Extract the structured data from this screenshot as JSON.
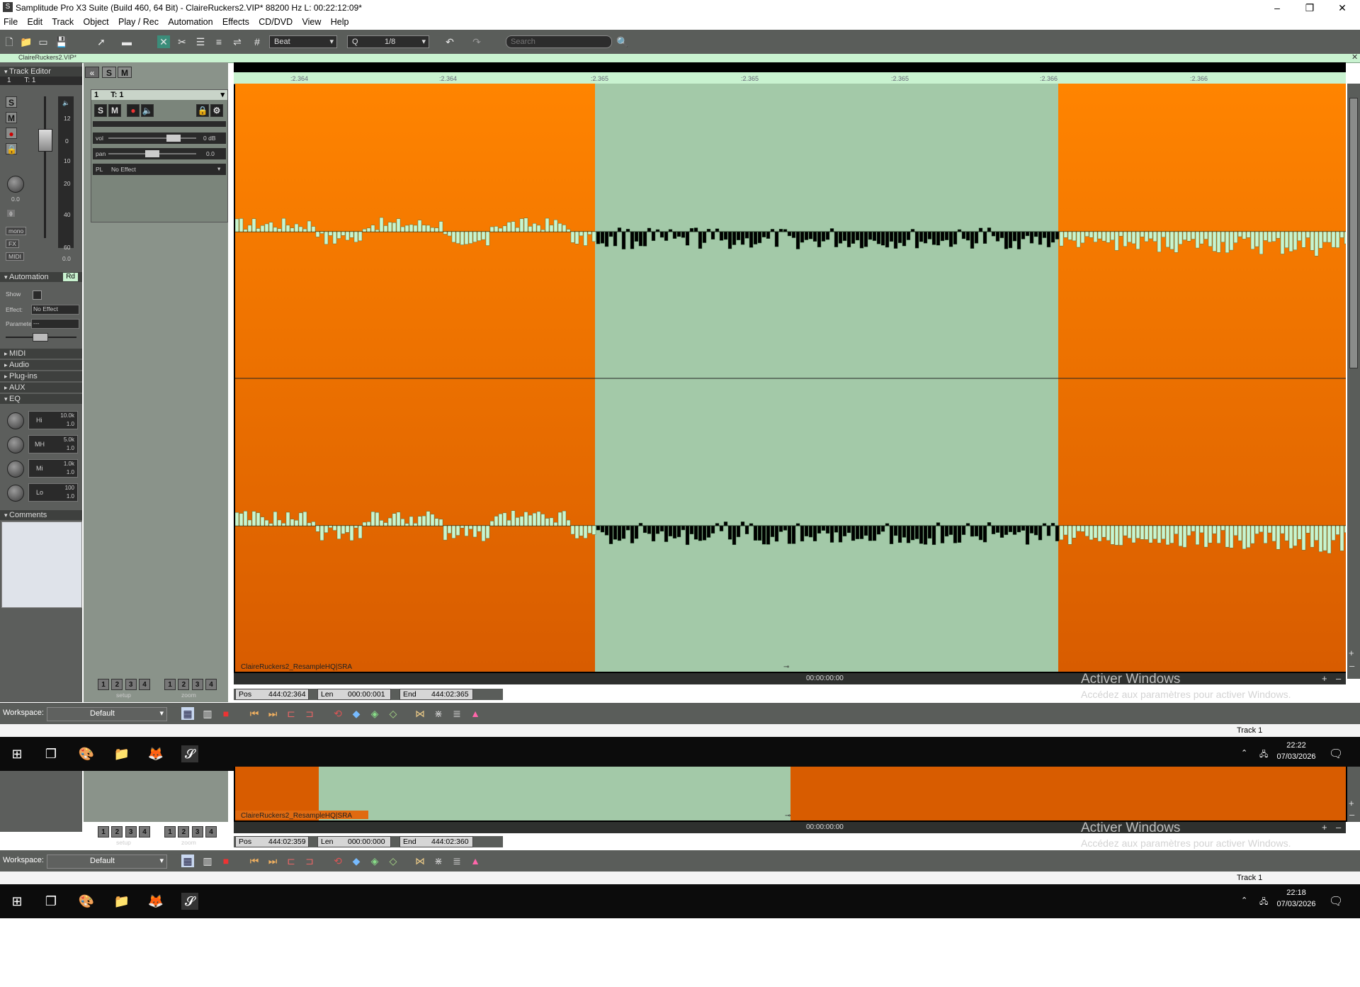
{
  "window": {
    "title": "Samplitude Pro X3 Suite (Build 460, 64 Bit)  -  ClaireRuckers2.VIP*   88200 Hz L: 00:22:12:09*",
    "minimize": "–",
    "maximize": "❐",
    "close": "✕"
  },
  "menu": [
    "File",
    "Edit",
    "Track",
    "Object",
    "Play / Rec",
    "Automation",
    "Effects",
    "CD/DVD",
    "View",
    "Help"
  ],
  "toolbar": {
    "grid_mode": "Beat",
    "quantize_label": "Q",
    "quantize_value": "1/8",
    "search_placeholder": "Search"
  },
  "project_tab": "ClaireRuckers2.VIP*",
  "track_editor": {
    "header": "Track Editor",
    "track_number": "1",
    "track_name": "T: 1",
    "volume_db": "0.0",
    "meter_scale": [
      "12",
      "0",
      "10",
      "20",
      "40",
      "60",
      "0.0"
    ],
    "mono_label": "mono",
    "fx_label": "FX",
    "midi_label": "MIDI",
    "solo": "S",
    "mute": "M"
  },
  "automation": {
    "header": "Automation",
    "mode": "Rd",
    "show_label": "Show",
    "effect_label": "Effect:",
    "effect_value": "No Effect",
    "parameter_label": "Parameter",
    "parameter_value": "---"
  },
  "sections": [
    "MIDI",
    "Audio",
    "Plug-ins",
    "AUX",
    "EQ"
  ],
  "eq": [
    {
      "band": "Hi",
      "freq": "10.0k",
      "gain": "1.0"
    },
    {
      "band": "MH",
      "freq": "5.0k",
      "gain": "1.0"
    },
    {
      "band": "Mi",
      "freq": "1.0k",
      "gain": "1.0"
    },
    {
      "band": "Lo",
      "freq": "100",
      "gain": "1.0"
    }
  ],
  "comments_header": "Comments",
  "track_header": {
    "number": "1",
    "name": "T: 1",
    "solo": "S",
    "mute": "M",
    "vol_label": "vol",
    "vol_value": "0 dB",
    "pan_label": "pan",
    "pan_value": "0.0",
    "plugin_label": "PL",
    "plugin_value": "No Effect"
  },
  "setup_buttons": [
    "1",
    "2",
    "3",
    "4"
  ],
  "setup_label": "setup",
  "zoom_buttons": [
    "1",
    "2",
    "3",
    "4"
  ],
  "zoom_label": "zoom",
  "ruler_labels": [
    ":2.364",
    ":2.364",
    ":2.365",
    ":2.365",
    ":2.365",
    ":2.366",
    ":2.366"
  ],
  "object_label": "ClaireRuckers2_ResampleHQ|SRA",
  "timecode": "00:00:00:00",
  "top_view": {
    "pos_label": "Pos",
    "pos": "444:02:364",
    "len_label": "Len",
    "len": "000:00:001",
    "end_label": "End",
    "end": "444:02:365",
    "clock_time": "22:22",
    "clock_date": "07/03/2026"
  },
  "bottom_view": {
    "pos_label": "Pos",
    "pos": "444:02:359",
    "len_label": "Len",
    "len": "000:00:000",
    "end_label": "End",
    "end": "444:02:360",
    "clock_time": "22:18",
    "clock_date": "07/03/2026"
  },
  "workspace_label": "Workspace:",
  "workspace_value": "Default",
  "track_status": "Track 1",
  "watermark_title": "Activer Windows",
  "watermark_sub": "Accédez aux paramètres pour activer Windows.",
  "colors": {
    "waveform_bg_top": "#ff8400",
    "waveform_bg_bottom": "#d85c00",
    "selection": "#a3c9a8",
    "wave_light": "#c9f5cf",
    "wave_dark": "#000000"
  }
}
